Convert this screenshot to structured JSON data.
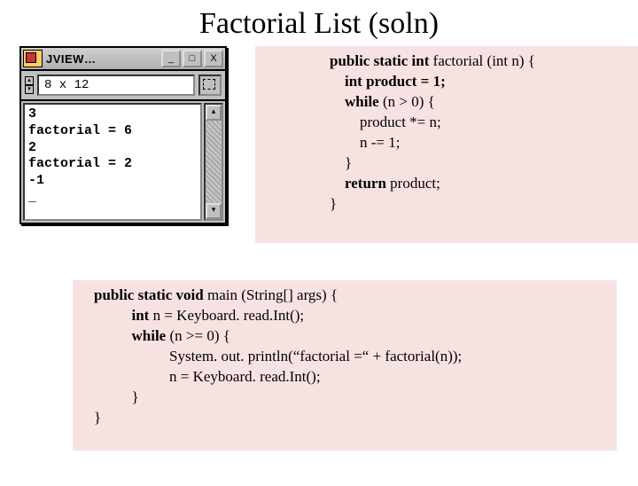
{
  "title": "Factorial List (soln)",
  "window": {
    "title": "JVIEW…",
    "min_glyph": "_",
    "max_glyph": "□",
    "close_glyph": "X",
    "font_label": "8 x 12",
    "spin_up": "▴",
    "spin_down": "▾",
    "scroll_up": "▴",
    "scroll_down": "▾",
    "console_lines": [
      "3",
      "factorial = 6",
      "2",
      "factorial = 2",
      "-1",
      "_"
    ]
  },
  "code_top": [
    {
      "b": true,
      "t": "public static int "
    },
    {
      "b": false,
      "t": "factorial (int n) {\n"
    },
    {
      "b": true,
      "t": "    int product = 1;\n"
    },
    {
      "b": true,
      "t": "    while "
    },
    {
      "b": false,
      "t": "(n > 0) {\n"
    },
    {
      "b": false,
      "t": "        product *= n;\n"
    },
    {
      "b": false,
      "t": "        n -= 1;\n"
    },
    {
      "b": false,
      "t": "    }\n"
    },
    {
      "b": true,
      "t": "    return "
    },
    {
      "b": false,
      "t": "product;\n"
    },
    {
      "b": false,
      "t": "}"
    }
  ],
  "code_bot": [
    {
      "b": true,
      "t": "public static void "
    },
    {
      "b": false,
      "t": "main (String[] args) {\n"
    },
    {
      "b": true,
      "t": "          int "
    },
    {
      "b": false,
      "t": "n = Keyboard. read.Int();\n"
    },
    {
      "b": true,
      "t": "          while "
    },
    {
      "b": false,
      "t": "(n >= 0) {\n"
    },
    {
      "b": false,
      "t": "                    System. out. println(“factorial =“ + factorial(n));\n"
    },
    {
      "b": false,
      "t": "                    n = Keyboard. read.Int();\n"
    },
    {
      "b": false,
      "t": "          }\n"
    },
    {
      "b": false,
      "t": "}"
    }
  ]
}
